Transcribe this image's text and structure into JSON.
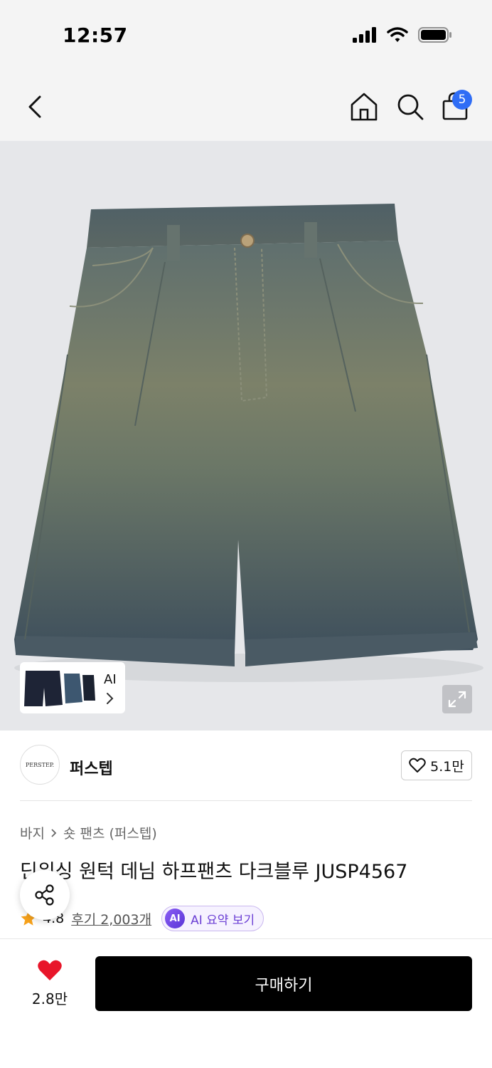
{
  "status_bar": {
    "time": "12:57"
  },
  "header": {
    "cart_count": "5"
  },
  "gallery": {
    "thumb_ai_label": "AI"
  },
  "brand": {
    "logo_text": "PERSTEP.",
    "name": "퍼스텝",
    "like_count": "5.1만"
  },
  "product": {
    "breadcrumb": [
      "바지",
      "숏 팬츠 (퍼스텝)"
    ],
    "title": "딘워싱 원턱 데님 하프팬츠 다크블루 JUSP4567",
    "rating": "4.8",
    "reviews": "후기 2,003개",
    "ai_badge": "AI",
    "ai_summary": "AI 요약 보기"
  },
  "bottom_bar": {
    "wish_count": "2.8만",
    "buy_label": "구매하기"
  },
  "colors": {
    "accent_blue": "#2f6df5",
    "ai_purple": "#6b3fd4",
    "heart_red": "#e8162a",
    "star": "#f7a21b"
  }
}
